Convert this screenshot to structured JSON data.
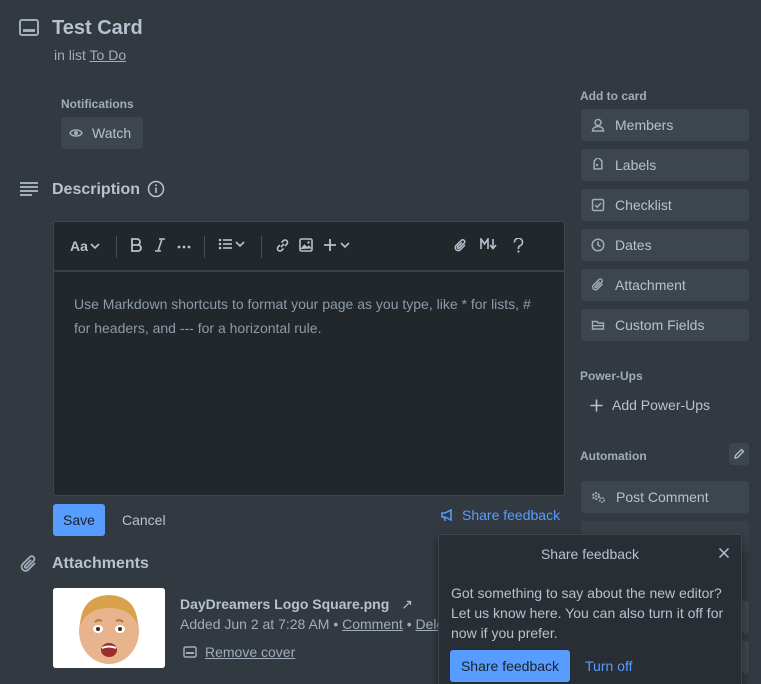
{
  "card": {
    "title": "Test Card",
    "in_list_prefix": "in list",
    "list_name": "To Do"
  },
  "notifications": {
    "label": "Notifications",
    "watch_label": "Watch"
  },
  "description": {
    "heading": "Description",
    "placeholder": "Use Markdown shortcuts to format your page as you type, like * for lists, # for headers, and --- for a horizontal rule.",
    "save_label": "Save",
    "cancel_label": "Cancel",
    "share_feedback_label": "Share feedback",
    "toolbar": {
      "text_style": "Aa"
    }
  },
  "attachments": {
    "heading": "Attachments",
    "file_name": "DayDreamers Logo Square.png",
    "external_arrow": "↗",
    "added_text": "Added Jun 2 at 7:28 AM •",
    "comment_label": "Comment",
    "separator": "•",
    "delete_label": "Dele",
    "remove_cover_label": "Remove cover"
  },
  "sidebar": {
    "add_to_card_label": "Add to card",
    "items": [
      {
        "label": "Members",
        "icon": "person-icon"
      },
      {
        "label": "Labels",
        "icon": "tag-icon"
      },
      {
        "label": "Checklist",
        "icon": "checkbox-icon"
      },
      {
        "label": "Dates",
        "icon": "clock-icon"
      },
      {
        "label": "Attachment",
        "icon": "paperclip-icon"
      },
      {
        "label": "Custom Fields",
        "icon": "custom-fields-icon"
      }
    ],
    "powerups_label": "Power-Ups",
    "add_powerups_label": "Add Power-Ups",
    "automation_label": "Automation",
    "post_comment_label": "Post Comment"
  },
  "popup": {
    "title": "Share feedback",
    "body": "Got something to say about the new editor? Let us know here. You can also turn it off for now if you prefer.",
    "share_button": "Share feedback",
    "turn_off_button": "Turn off"
  },
  "colors": {
    "background": "#323940",
    "accent": "#579dff",
    "button": "#3d454d",
    "editor": "#22272b"
  }
}
